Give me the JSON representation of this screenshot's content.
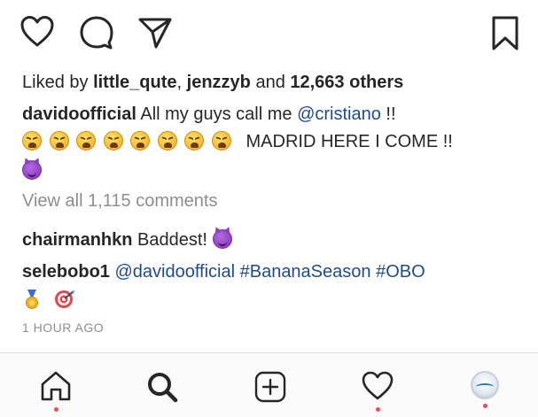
{
  "likes": {
    "prefix": "Liked by ",
    "user1": "little_qute",
    "sep": ", ",
    "user2": "jenzzyb",
    "and": " and ",
    "others": "12,663 others"
  },
  "caption": {
    "username": "davidoofficial",
    "text_before": " All my guys call me ",
    "mention": "@cristiano",
    "text_after": " !!",
    "line2_text": "MADRID HERE I COME !!",
    "emoji_line1": [
      "tired-face-emoji",
      "tired-face-emoji",
      "tired-face-emoji",
      "tired-face-emoji",
      "tired-face-emoji",
      "tired-face-emoji",
      "tired-face-emoji",
      "tired-face-emoji"
    ],
    "emoji_line2": [
      "smiling-devil-emoji"
    ]
  },
  "view_comments": "View all 1,115 comments",
  "comments": [
    {
      "username": "chairmanhkn",
      "text": " Baddest! "
    },
    {
      "username": "selebobo1",
      "mention": " @davidoofficial",
      "tags": " #BananaSeason #OBO"
    }
  ],
  "timestamp": "1 HOUR AGO",
  "icons": {
    "like": "heart-icon",
    "comment": "comment-bubble-icon",
    "share": "paper-plane-icon",
    "save": "bookmark-icon",
    "home": "home-icon",
    "search": "search-icon",
    "add": "add-post-icon",
    "activity": "heart-icon",
    "profile": "profile-avatar"
  },
  "colors": {
    "link": "#1e4b8f",
    "muted": "#8e8e8e",
    "notification_dot": "#ed4956"
  }
}
